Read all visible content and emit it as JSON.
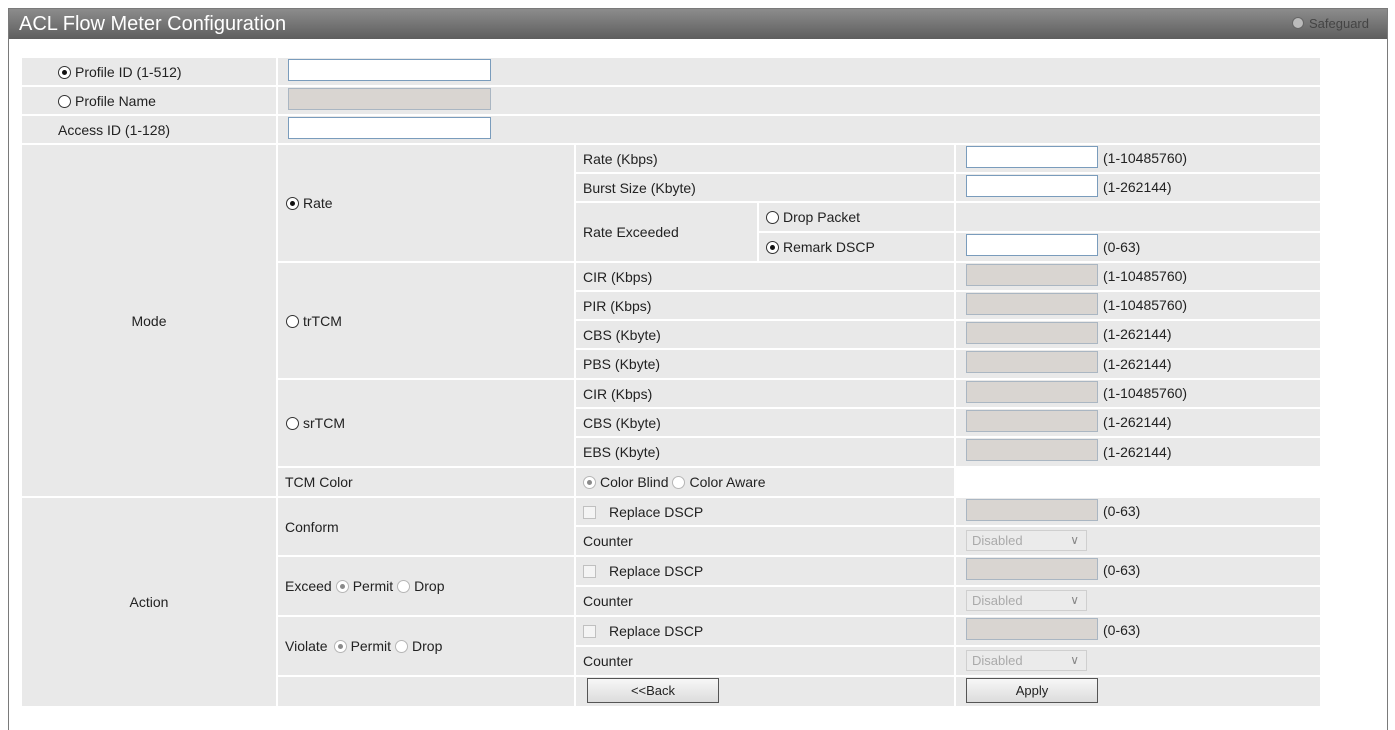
{
  "header": {
    "title": "ACL Flow Meter Configuration",
    "safeguard": "Safeguard"
  },
  "profile_id": {
    "label": "Profile ID (1-512)",
    "value": ""
  },
  "profile_name": {
    "label": "Profile Name",
    "value": ""
  },
  "access_id": {
    "label": "Access ID (1-128)",
    "value": ""
  },
  "mode": {
    "label": "Mode",
    "rate": {
      "label": "Rate",
      "rate_kbps": {
        "label": "Rate (Kbps)",
        "range": "(1-10485760)",
        "value": ""
      },
      "burst_size": {
        "label": "Burst Size (Kbyte)",
        "range": "(1-262144)",
        "value": ""
      },
      "rate_exceeded": {
        "label": "Rate Exceeded",
        "drop_packet": "Drop Packet",
        "remark_dscp": "Remark DSCP",
        "dscp_range": "(0-63)",
        "dscp_value": ""
      }
    },
    "trtcm": {
      "label": "trTCM",
      "cir": {
        "label": "CIR (Kbps)",
        "range": "(1-10485760)"
      },
      "pir": {
        "label": "PIR (Kbps)",
        "range": "(1-10485760)"
      },
      "cbs": {
        "label": "CBS (Kbyte)",
        "range": "(1-262144)"
      },
      "pbs": {
        "label": "PBS (Kbyte)",
        "range": "(1-262144)"
      }
    },
    "srtcm": {
      "label": "srTCM",
      "cir": {
        "label": "CIR (Kbps)",
        "range": "(1-10485760)"
      },
      "cbs": {
        "label": "CBS (Kbyte)",
        "range": "(1-262144)"
      },
      "ebs": {
        "label": "EBS (Kbyte)",
        "range": "(1-262144)"
      }
    },
    "tcm_color": {
      "label": "TCM Color",
      "color_blind": "Color Blind",
      "color_aware": "Color Aware"
    }
  },
  "action": {
    "label": "Action",
    "conform": {
      "label": "Conform",
      "replace_dscp": "Replace DSCP",
      "range": "(0-63)",
      "counter": "Counter",
      "counter_value": "Disabled"
    },
    "exceed": {
      "label": "Exceed",
      "permit": "Permit",
      "drop": "Drop",
      "replace_dscp": "Replace DSCP",
      "range": "(0-63)",
      "counter": "Counter",
      "counter_value": "Disabled"
    },
    "violate": {
      "label": "Violate",
      "permit": "Permit",
      "drop": "Drop",
      "replace_dscp": "Replace DSCP",
      "range": "(0-63)",
      "counter": "Counter",
      "counter_value": "Disabled"
    }
  },
  "buttons": {
    "back": "<<Back",
    "apply": "Apply"
  }
}
